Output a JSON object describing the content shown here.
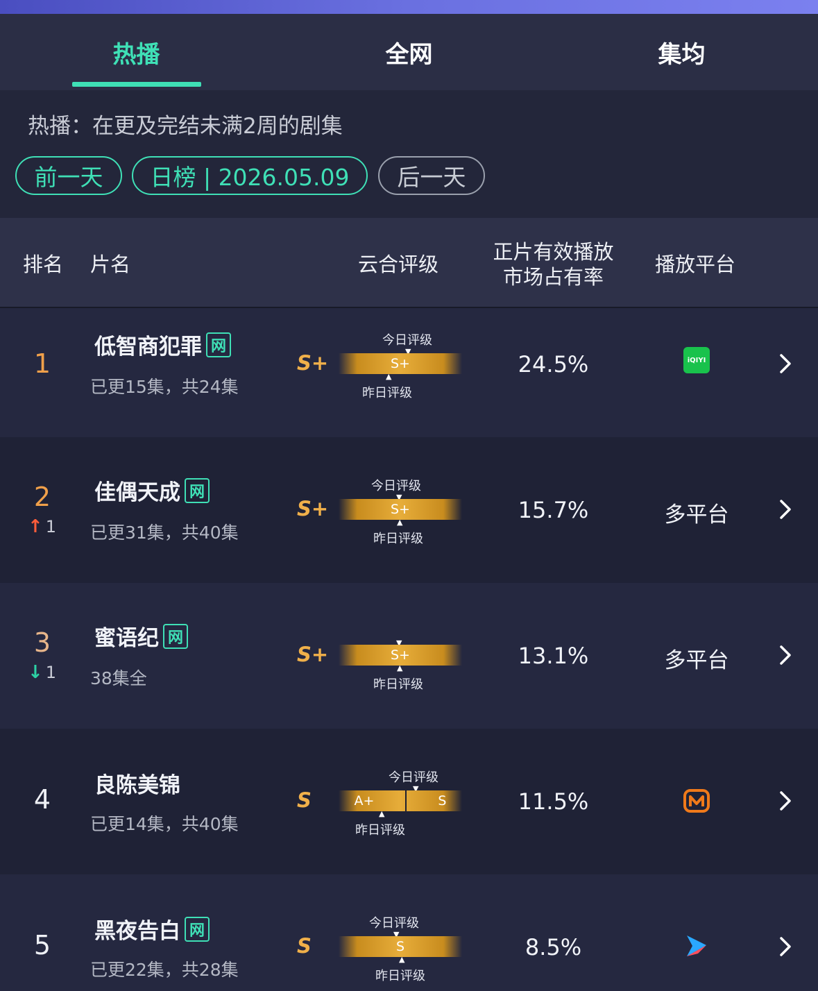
{
  "tabs": [
    {
      "label": "热播",
      "active": true
    },
    {
      "label": "全网",
      "active": false
    },
    {
      "label": "集均",
      "active": false
    }
  ],
  "description": "热播：在更及完结未满2周的剧集",
  "nav": {
    "prev_label": "前一天",
    "date_label": "日榜 | 2026.05.09",
    "next_label": "后一天"
  },
  "columns": {
    "rank": "排名",
    "title": "片名",
    "rating": "云合评级",
    "share_line1": "正片有效播放",
    "share_line2": "市场占有率",
    "platform": "播放平台"
  },
  "bar_labels": {
    "today": "今日评级",
    "yesterday": "昨日评级"
  },
  "colors": {
    "accent": "#3fe0b6",
    "gold": "#f0b04a",
    "up": "#ff5d3a",
    "down": "#2dd1a5"
  },
  "rows": [
    {
      "rank": "1",
      "title": "低智商犯罪",
      "net": "网",
      "episodes": "已更15集，共24集",
      "grade": "S+",
      "bar_left": "S+",
      "bar_right": "",
      "share": "24.5%",
      "platform_icon": "iqiyi-icon",
      "platform_text": "iQIYI"
    },
    {
      "rank": "2",
      "delta": "1",
      "delta_dir": "up",
      "title": "佳偶天成",
      "net": "网",
      "episodes": "已更31集，共40集",
      "grade": "S+",
      "bar_left": "S+",
      "bar_right": "",
      "share": "15.7%",
      "platform_icon": "",
      "platform_text": "多平台"
    },
    {
      "rank": "3",
      "delta": "1",
      "delta_dir": "down",
      "title": "蜜语纪",
      "net": "网",
      "episodes": "38集全",
      "grade": "S+",
      "bar_left": "S+",
      "bar_right": "",
      "share": "13.1%",
      "platform_icon": "",
      "platform_text": "多平台"
    },
    {
      "rank": "4",
      "title": "良陈美锦",
      "net": "",
      "episodes": "已更14集，共40集",
      "grade": "S",
      "bar_left": "A+",
      "bar_right": "S",
      "share": "11.5%",
      "platform_icon": "mango-tv-icon",
      "platform_text": ""
    },
    {
      "rank": "5",
      "title": "黑夜告白",
      "net": "网",
      "episodes": "已更22集，共28集",
      "grade": "S",
      "bar_left": "S",
      "bar_right": "",
      "share": "8.5%",
      "platform_icon": "youku-icon",
      "platform_text": ""
    }
  ]
}
